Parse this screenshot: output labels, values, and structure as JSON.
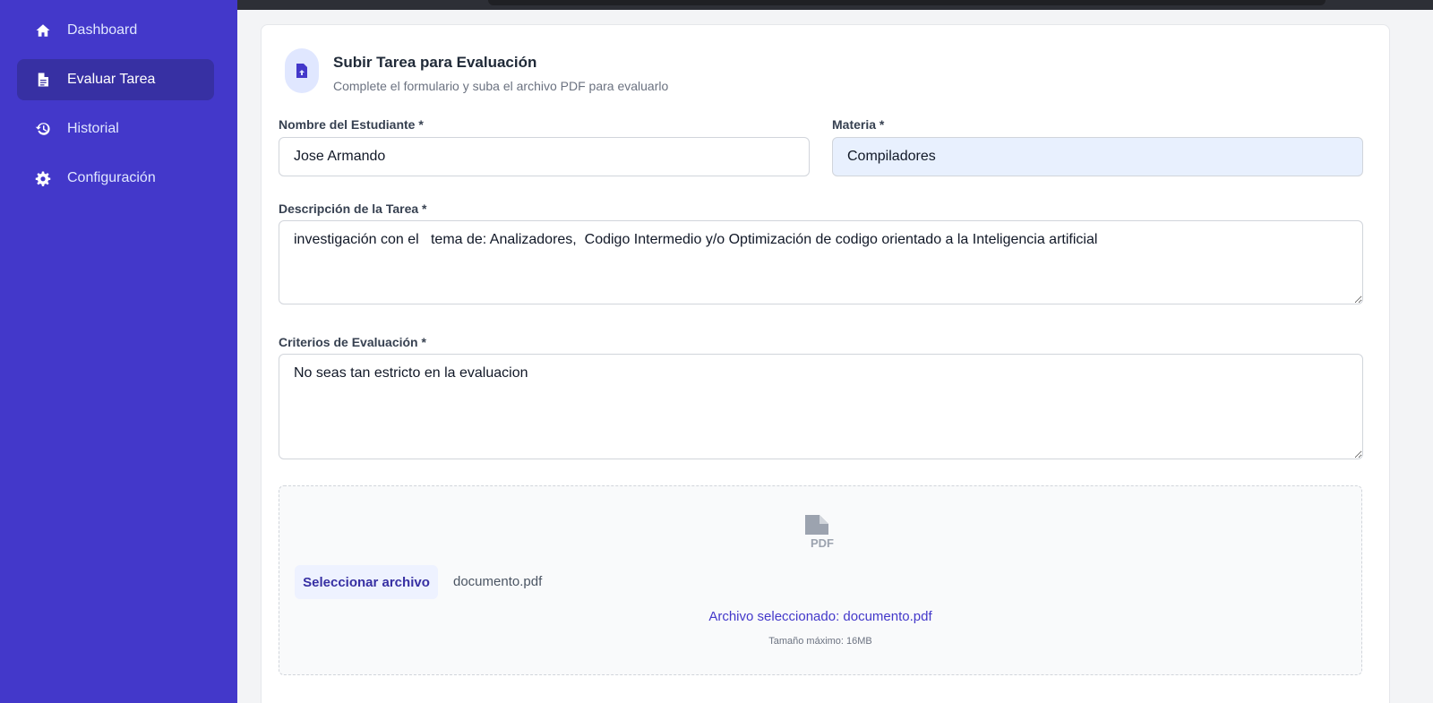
{
  "sidebar": {
    "items": [
      {
        "label": "Dashboard",
        "icon": "home-icon",
        "active": false
      },
      {
        "label": "Evaluar Tarea",
        "icon": "file-icon",
        "active": true
      },
      {
        "label": "Historial",
        "icon": "history-icon",
        "active": false
      },
      {
        "label": "Configuración",
        "icon": "gear-icon",
        "active": false
      }
    ]
  },
  "header": {
    "icon": "file-upload-icon",
    "title": "Subir Tarea para Evaluación",
    "subtitle": "Complete el formulario y suba el archivo PDF para evaluarlo"
  },
  "form": {
    "student": {
      "label": "Nombre del Estudiante *",
      "value": "Jose Armando"
    },
    "subject": {
      "label": "Materia *",
      "value": "Compiladores"
    },
    "description": {
      "label": "Descripción de la Tarea *",
      "value": "investigación con el   tema de: Analizadores,  Codigo Intermedio y/o Optimización de codigo orientado a la Inteligencia artificial"
    },
    "criteria": {
      "label": "Criterios de Evaluación *",
      "value": "No seas tan estricto en la evaluacion"
    }
  },
  "upload": {
    "icon": "pdf-file-icon",
    "button_label": "Seleccionar archivo",
    "file_name": "documento.pdf",
    "selected_text": "Archivo seleccionado: documento.pdf",
    "max_size_text": "Tamaño máximo: 16MB"
  },
  "colors": {
    "sidebar_bg": "#4338ca",
    "sidebar_active": "#3730a3",
    "accent": "#4338ca",
    "autofill_bg": "#e8f0fe"
  }
}
